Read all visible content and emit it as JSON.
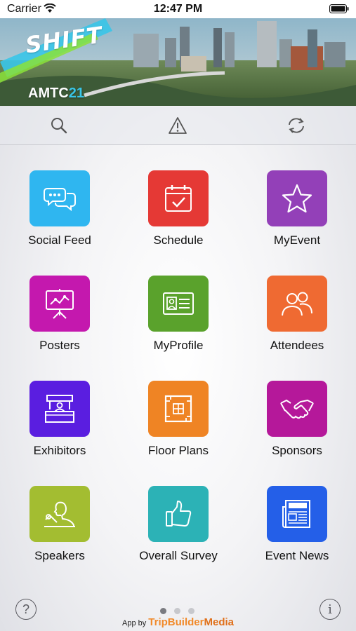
{
  "status_bar": {
    "carrier": "Carrier",
    "time": "12:47 PM"
  },
  "banner": {
    "logo_text": "SHIFT",
    "event_prefix": "AMTC",
    "event_suffix": "21"
  },
  "toolbar": {
    "icons": [
      "search-icon",
      "warning-icon",
      "refresh-icon"
    ]
  },
  "tiles": [
    {
      "label": "Social Feed",
      "color": "#2fb6f0",
      "icon": "chat-bubbles-icon"
    },
    {
      "label": "Schedule",
      "color": "#e53935",
      "icon": "calendar-check-icon"
    },
    {
      "label": "MyEvent",
      "color": "#9340b8",
      "icon": "star-icon"
    },
    {
      "label": "Posters",
      "color": "#c418ae",
      "icon": "presentation-board-icon"
    },
    {
      "label": "MyProfile",
      "color": "#5aa22c",
      "icon": "id-card-icon"
    },
    {
      "label": "Attendees",
      "color": "#ef6a32",
      "icon": "people-icon"
    },
    {
      "label": "Exhibitors",
      "color": "#5a1ee0",
      "icon": "exhibit-booth-icon"
    },
    {
      "label": "Floor Plans",
      "color": "#ef8424",
      "icon": "floor-plan-icon"
    },
    {
      "label": "Sponsors",
      "color": "#b5189a",
      "icon": "handshake-icon"
    },
    {
      "label": "Speakers",
      "color": "#a3bd31",
      "icon": "speaker-icon"
    },
    {
      "label": "Overall Survey",
      "color": "#2cb2b6",
      "icon": "thumbs-up-icon"
    },
    {
      "label": "Event News",
      "color": "#245fe8",
      "icon": "newspaper-icon"
    }
  ],
  "pager": {
    "pages": 3,
    "active": 0
  },
  "footer": {
    "help_symbol": "?",
    "info_symbol": "i",
    "credit_prefix": "App by",
    "credit_brand_a": "TripBuilder",
    "credit_brand_b": "Media"
  }
}
